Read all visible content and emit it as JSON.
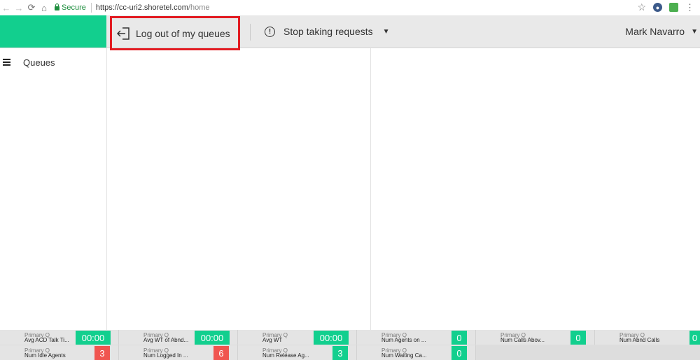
{
  "browser": {
    "secure_label": "Secure",
    "url_host": "https://cc-uri2.shoretel.com",
    "url_path": "/home"
  },
  "header": {
    "logout_label": "Log out of my queues",
    "stop_label": "Stop taking requests",
    "user_name": "Mark Navarro"
  },
  "sidebar": {
    "items": [
      {
        "label": "Queues"
      }
    ]
  },
  "stats": {
    "row1": [
      {
        "queue": "Primary Q",
        "name": "Avg ACD Talk Ti...",
        "value": "00:00",
        "color": "#12cf8e"
      },
      {
        "queue": "Primary Q",
        "name": "Avg WT of Abnd...",
        "value": "00:00",
        "color": "#12cf8e"
      },
      {
        "queue": "Primary Q",
        "name": "Avg WT",
        "value": "00:00",
        "color": "#12cf8e"
      },
      {
        "queue": "Primary Q",
        "name": "Num Agents on ...",
        "value": "0",
        "color": "#12cf8e"
      },
      {
        "queue": "Primary Q",
        "name": "Num Calls Abov...",
        "value": "0",
        "color": "#12cf8e"
      },
      {
        "queue": "Primary Q",
        "name": "Num Abnd Calls",
        "value": "0",
        "color": "#12cf8e"
      }
    ],
    "row2": [
      {
        "queue": "Primary Q",
        "name": "Num Idle Agents",
        "value": "3",
        "color": "#f05550"
      },
      {
        "queue": "Primary Q",
        "name": "Num Logged In ...",
        "value": "6",
        "color": "#f05550"
      },
      {
        "queue": "Primary Q",
        "name": "Num Release Ag...",
        "value": "3",
        "color": "#12cf8e"
      },
      {
        "queue": "Primary Q",
        "name": "Num Waiting Ca...",
        "value": "0",
        "color": "#12cf8e"
      }
    ]
  },
  "colors": {
    "brand": "#12cf8e",
    "alert": "#f05550",
    "highlight_box": "#e21c22"
  }
}
